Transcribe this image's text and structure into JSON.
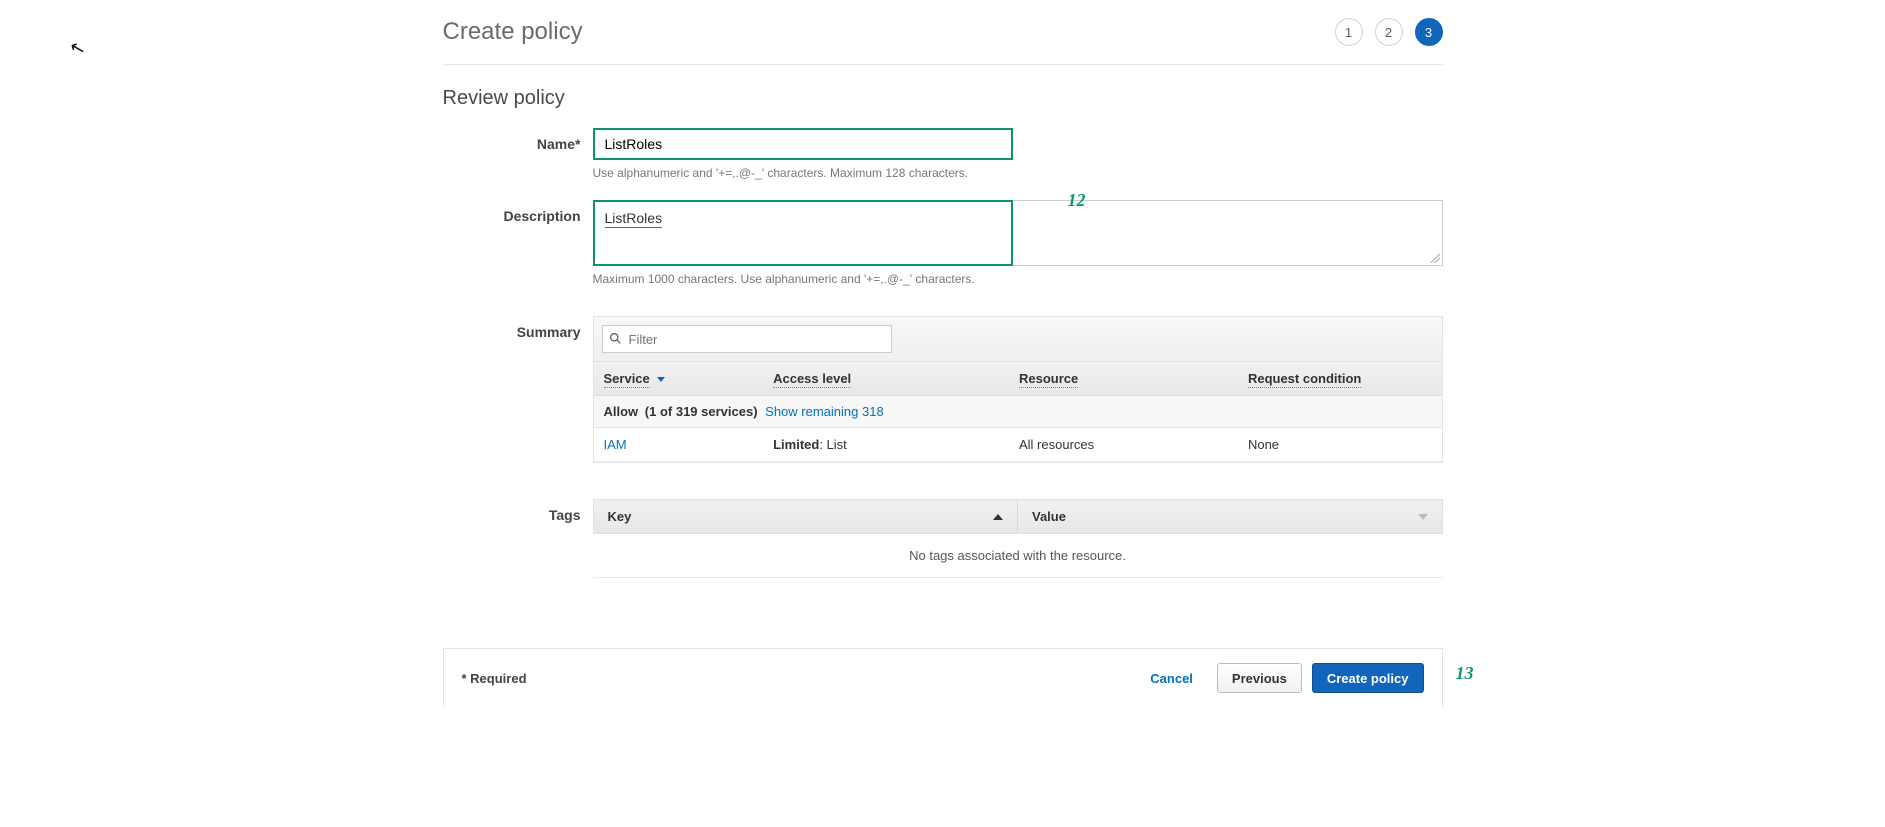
{
  "header": {
    "title": "Create policy",
    "steps": [
      "1",
      "2",
      "3"
    ],
    "activeStep": "3"
  },
  "section": {
    "title": "Review policy"
  },
  "form": {
    "nameLabel": "Name*",
    "nameValue": "ListRoles",
    "nameHint": "Use alphanumeric and '+=,.@-_' characters. Maximum 128 characters.",
    "descLabel": "Description",
    "descValue": "ListRoles",
    "descHint": "Maximum 1000 characters. Use alphanumeric and '+=,.@-_' characters.",
    "summaryLabel": "Summary",
    "tagsLabel": "Tags"
  },
  "annotations": {
    "a12": "12",
    "a13": "13"
  },
  "summary": {
    "filterPlaceholder": "Filter",
    "cols": {
      "service": "Service",
      "access": "Access level",
      "resource": "Resource",
      "request": "Request condition"
    },
    "groupPrefix": "Allow",
    "groupCount": "(1 of 319 services)",
    "groupLink": "Show remaining 318",
    "row": {
      "service": "IAM",
      "accessBold": "Limited",
      "accessRest": ": List",
      "resource": "All resources",
      "request": "None"
    }
  },
  "tags": {
    "keyHeader": "Key",
    "valueHeader": "Value",
    "empty": "No tags associated with the resource."
  },
  "footer": {
    "required": "* Required",
    "cancel": "Cancel",
    "previous": "Previous",
    "create": "Create policy"
  }
}
